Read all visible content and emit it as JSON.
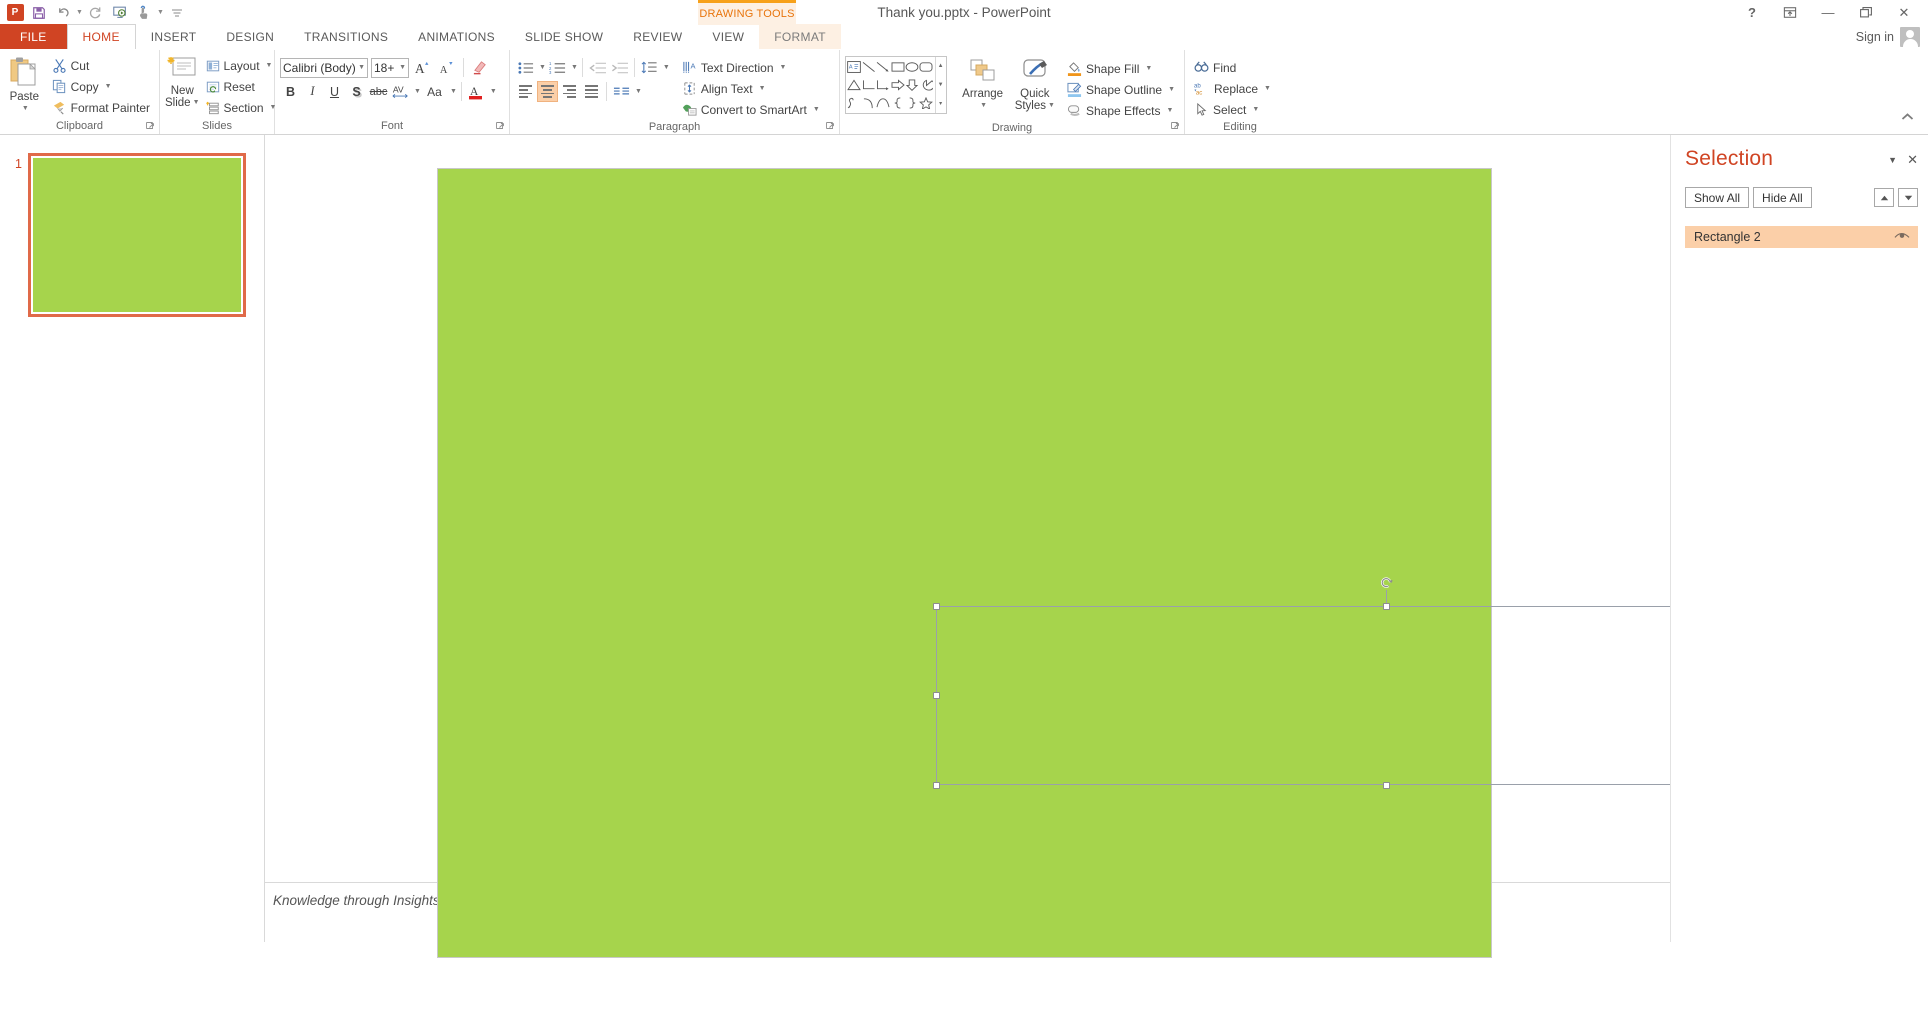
{
  "app": {
    "title": "Thank you.pptx - PowerPoint",
    "logo_text": "P",
    "contextual_tab_banner": "DRAWING TOOLS",
    "sign_in": "Sign in"
  },
  "quick_access": [
    {
      "name": "save-icon",
      "glyph": "Ὃe"
    },
    {
      "name": "undo-icon",
      "glyph": "↶"
    },
    {
      "name": "redo-icon",
      "glyph": "↻"
    },
    {
      "name": "start-slideshow-icon",
      "glyph": "▶"
    },
    {
      "name": "touch-mode-icon",
      "glyph": "☝"
    },
    {
      "name": "customize-qat-icon",
      "glyph": "≡"
    }
  ],
  "window_controls": {
    "help": "?",
    "ribbon_display": "⬚",
    "minimize": "—",
    "restore": "❐",
    "close": "✕"
  },
  "tabs": [
    {
      "label": "FILE",
      "kind": "file"
    },
    {
      "label": "HOME",
      "kind": "active"
    },
    {
      "label": "INSERT",
      "kind": "normal"
    },
    {
      "label": "DESIGN",
      "kind": "normal"
    },
    {
      "label": "TRANSITIONS",
      "kind": "normal"
    },
    {
      "label": "ANIMATIONS",
      "kind": "normal"
    },
    {
      "label": "SLIDE SHOW",
      "kind": "normal"
    },
    {
      "label": "REVIEW",
      "kind": "normal"
    },
    {
      "label": "VIEW",
      "kind": "normal"
    },
    {
      "label": "FORMAT",
      "kind": "ctx"
    }
  ],
  "ribbon": {
    "collapse_icon": "▲",
    "clipboard": {
      "title": "Clipboard",
      "paste": "Paste",
      "cut": "Cut",
      "copy": "Copy",
      "format_painter": "Format Painter",
      "launcher": "⬎"
    },
    "slides": {
      "title": "Slides",
      "new_slide_line1": "New",
      "new_slide_line2": "Slide",
      "layout": "Layout",
      "reset": "Reset",
      "section": "Section"
    },
    "font": {
      "title": "Font",
      "font_name": "Calibri (Body)",
      "font_size": "18+",
      "grow": "A",
      "shrink": "A",
      "clear_formatting": "✐",
      "bold": "B",
      "italic": "I",
      "underline": "U",
      "shadow": "S",
      "strikethrough": "abc",
      "character_spacing": "AV",
      "change_case": "Aa",
      "font_color": "A",
      "font_color_hex": "#e02020",
      "launcher": "⬎"
    },
    "paragraph": {
      "title": "Paragraph",
      "text_direction": "Text Direction",
      "align_text": "Align Text",
      "convert_smartart": "Convert to SmartArt",
      "launcher": "⬎"
    },
    "drawing": {
      "title": "Drawing",
      "arrange_line1": "Arrange",
      "quick_styles_line1": "Quick",
      "quick_styles_line2": "Styles",
      "shape_fill": "Shape Fill",
      "shape_outline": "Shape Outline",
      "shape_effects": "Shape Effects",
      "launcher": "⬎"
    },
    "editing": {
      "title": "Editing",
      "find": "Find",
      "replace": "Replace",
      "select": "Select"
    }
  },
  "slide_panel": {
    "slide_number": "1",
    "slide_fill_hex": "#a6d44c",
    "selection_border_hex": "#e06a49"
  },
  "slide": {
    "fill_hex": "#a6d44c",
    "shape_name": "Rectangle 2"
  },
  "notes": {
    "text": "Knowledge through Insights"
  },
  "selection_pane": {
    "title": "Selection",
    "collapse_icon": "▼",
    "close_icon": "✕",
    "show_all": "Show All",
    "hide_all": "Hide All",
    "move_up_icon": "▲",
    "move_down_icon": "▼",
    "items": [
      {
        "label": "Rectangle 2",
        "visible_icon": "eye-icon",
        "selected": true
      }
    ]
  }
}
